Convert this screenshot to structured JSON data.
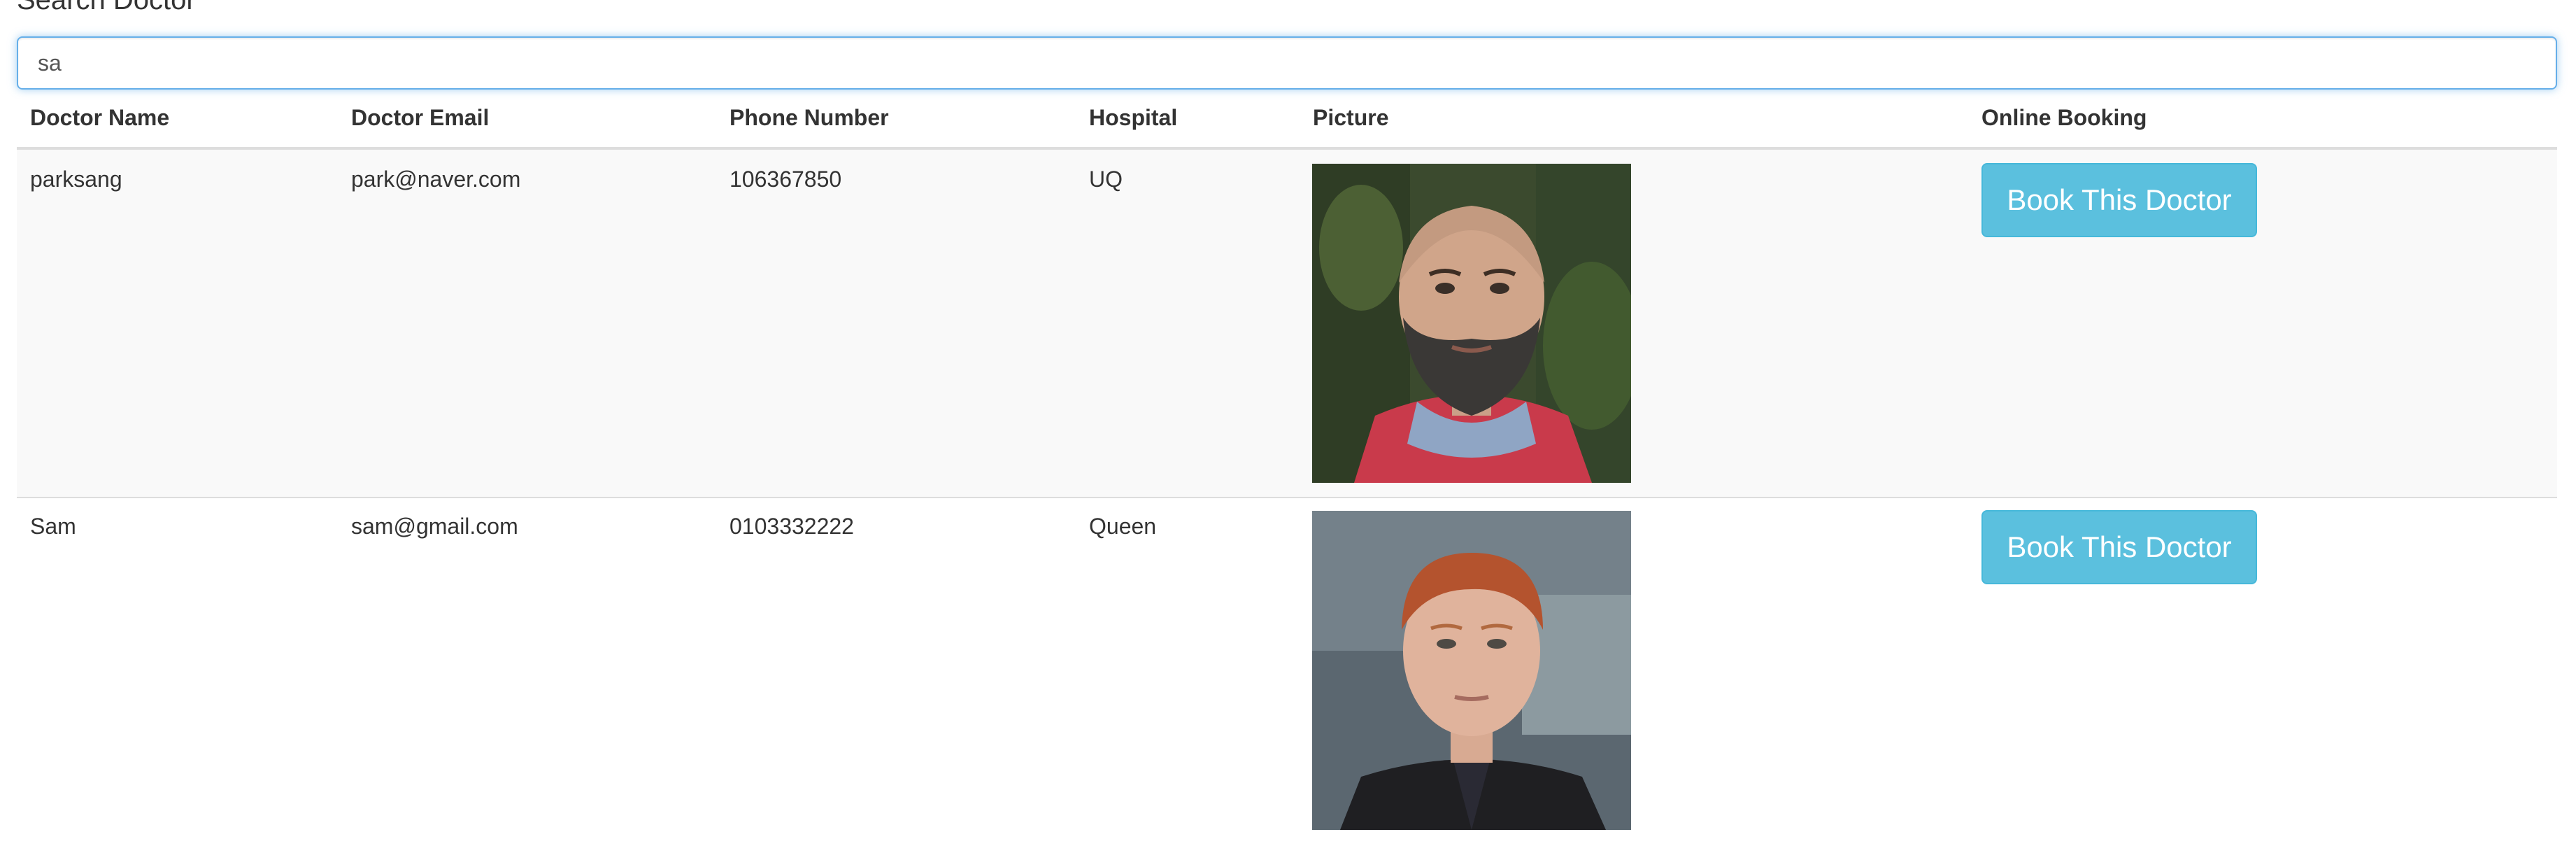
{
  "search": {
    "label": "Search Doctor",
    "value": "sa"
  },
  "table": {
    "headers": [
      "Doctor Name",
      "Doctor Email",
      "Phone Number",
      "Hospital",
      "Picture",
      "Online Booking"
    ],
    "rows": [
      {
        "name": "parksang",
        "email": "park@naver.com",
        "phone": "106367850",
        "hospital": "UQ",
        "book_label": "Book This Doctor"
      },
      {
        "name": "Sam",
        "email": "sam@gmail.com",
        "phone": "0103332222",
        "hospital": "Queen",
        "book_label": "Book This Doctor"
      }
    ]
  },
  "colors": {
    "button": "#5bc0de",
    "focus_border": "#66afe9",
    "striped_row": "#f9f9f9"
  }
}
